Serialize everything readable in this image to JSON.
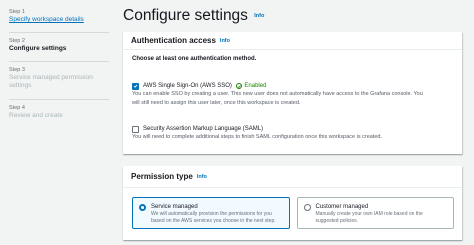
{
  "steps": [
    {
      "num": "Step 1",
      "title": "Specify workspace details"
    },
    {
      "num": "Step 2",
      "title": "Configure settings"
    },
    {
      "num": "Step 3",
      "title": "Service managed permission settings"
    },
    {
      "num": "Step 4",
      "title": "Review and create"
    }
  ],
  "page": {
    "title": "Configure settings",
    "info": "Info"
  },
  "auth": {
    "header": "Authentication access",
    "info": "Info",
    "choose": "Choose at least one authentication method.",
    "sso": {
      "label": "AWS Single Sign-On (AWS SSO)",
      "status": "Enabled",
      "checked": true,
      "desc1": "You can enable SSO by creating a user. This new user does not automatically have access to the Grafana console. You",
      "desc2": "will still need to assign this user later, once this workspace is created."
    },
    "saml": {
      "label": "Security Assertion Markup Language (SAML)",
      "checked": false,
      "desc": "You will need to complete additional steps to finish SAML configuration once this workspace is created."
    }
  },
  "permission": {
    "header": "Permission type",
    "info": "Info",
    "options": [
      {
        "title": "Service managed",
        "desc1": "We will automatically provision the permissions for you",
        "desc2": "based on the AWS services you choose in the next step.",
        "selected": true
      },
      {
        "title": "Customer managed",
        "desc1": "Manually create your own IAM role based on the",
        "desc2": "suggested policies.",
        "selected": false
      }
    ]
  },
  "colors": {
    "link": "#0073bb",
    "enabled": "#1d8102",
    "background": "#f2f3f3"
  },
  "icons": {
    "check": "checkmark-icon",
    "status": "success-circle-icon"
  }
}
